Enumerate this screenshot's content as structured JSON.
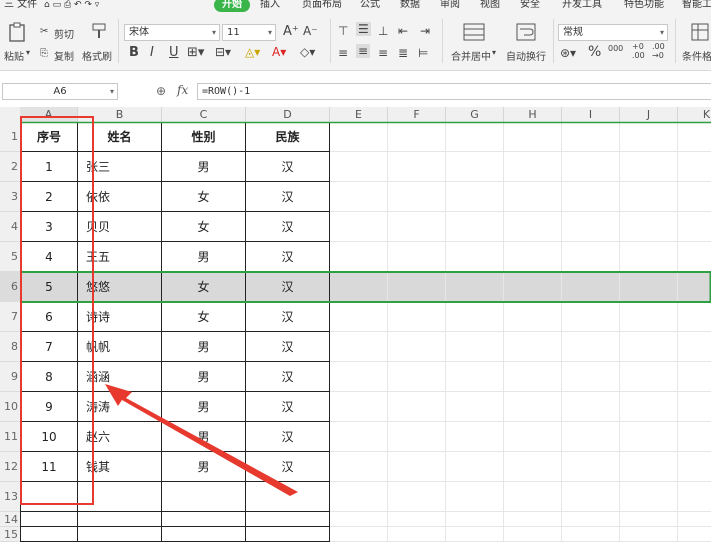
{
  "menubar": {
    "file": "三 文件",
    "items": [
      "开始",
      "插入",
      "页面布局",
      "公式",
      "数据",
      "审阅",
      "视图",
      "安全",
      "开发工具",
      "特色功能",
      "智能工"
    ]
  },
  "toolbar": {
    "paste": "粘贴",
    "cut": "剪切",
    "copy": "复制",
    "format_painter": "格式刷",
    "font_name": "宋体",
    "font_size": "11",
    "bold": "B",
    "italic": "I",
    "underline": "U",
    "grow_font": "A⁺",
    "shrink_font": "A⁻",
    "merge_center": "合并居中",
    "wrap_text": "自动换行",
    "number_format": "常规",
    "percent": "%",
    "thousands": "000",
    "inc_decimal": "+0\n.00",
    "dec_decimal": ".00\n→0",
    "conditional_format": "条件格"
  },
  "formulabar": {
    "name_box": "A6",
    "fx": "fx",
    "formula": "=ROW()-1"
  },
  "columns": [
    "A",
    "B",
    "C",
    "D",
    "E",
    "F",
    "G",
    "H",
    "I",
    "J",
    "K"
  ],
  "rows": [
    "1",
    "2",
    "3",
    "4",
    "5",
    "6",
    "7",
    "8",
    "9",
    "10",
    "11",
    "12",
    "13",
    "14",
    "15"
  ],
  "table": {
    "headers": [
      "序号",
      "姓名",
      "性别",
      "民族"
    ],
    "data": [
      [
        "1",
        "张三",
        "男",
        "汉"
      ],
      [
        "2",
        "依依",
        "女",
        "汉"
      ],
      [
        "3",
        "贝贝",
        "女",
        "汉"
      ],
      [
        "4",
        "王五",
        "男",
        "汉"
      ],
      [
        "5",
        "悠悠",
        "女",
        "汉"
      ],
      [
        "6",
        "诗诗",
        "女",
        "汉"
      ],
      [
        "7",
        "帆帆",
        "男",
        "汉"
      ],
      [
        "8",
        "涵涵",
        "男",
        "汉"
      ],
      [
        "9",
        "涛涛",
        "男",
        "汉"
      ],
      [
        "10",
        "赵六",
        "男",
        "汉"
      ],
      [
        "11",
        "钱其",
        "男",
        "汉"
      ]
    ]
  },
  "colors": {
    "accent": "#3bb54a",
    "selection": "#2ea043",
    "annotation": "#e8392f",
    "highlight_row": "#d9d9d9"
  }
}
